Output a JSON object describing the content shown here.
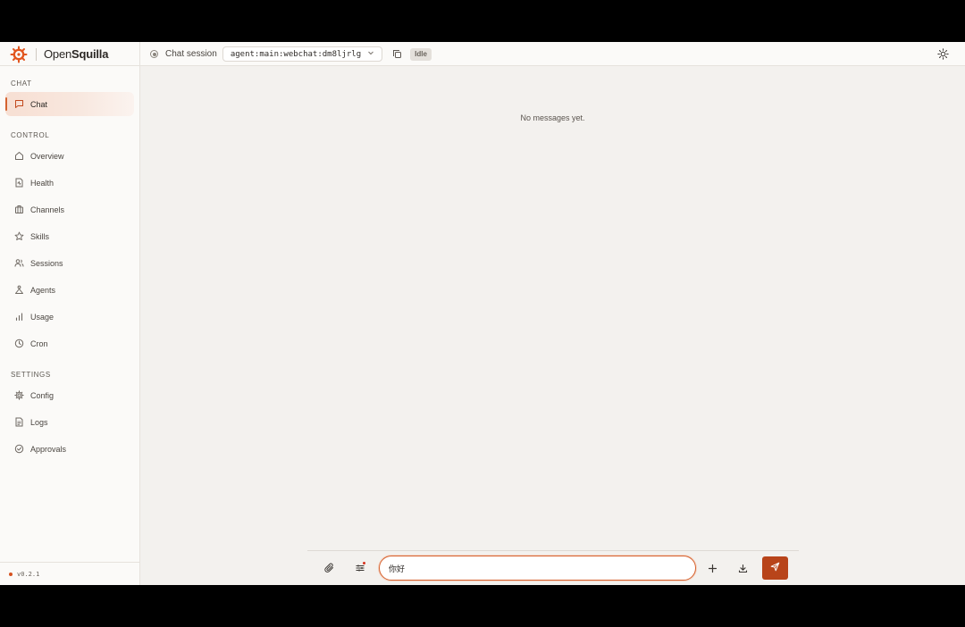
{
  "brand": {
    "name_prefix": "Open",
    "name_suffix": "Squilla",
    "logo_icon": "squid-logo-icon"
  },
  "header": {
    "session_label": "Chat session",
    "session_key": "agent:main:webchat:dm8ljrlg",
    "status": "Idle",
    "icons": {
      "status": "radio-dot-icon",
      "dropdown": "chevron-down-icon",
      "copy": "copy-icon",
      "theme": "sun-icon"
    }
  },
  "sidebar": {
    "sections": [
      {
        "title": "CHAT",
        "items": [
          {
            "label": "Chat",
            "icon": "message-square-icon",
            "active": true
          }
        ]
      },
      {
        "title": "CONTROL",
        "items": [
          {
            "label": "Overview",
            "icon": "home-icon"
          },
          {
            "label": "Health",
            "icon": "file-pulse-icon"
          },
          {
            "label": "Channels",
            "icon": "briefcase-icon"
          },
          {
            "label": "Skills",
            "icon": "star-icon"
          },
          {
            "label": "Sessions",
            "icon": "users-icon"
          },
          {
            "label": "Agents",
            "icon": "triangle-person-icon"
          },
          {
            "label": "Usage",
            "icon": "bar-chart-icon"
          },
          {
            "label": "Cron",
            "icon": "clock-icon"
          }
        ]
      },
      {
        "title": "SETTINGS",
        "items": [
          {
            "label": "Config",
            "icon": "gear-icon"
          },
          {
            "label": "Logs",
            "icon": "file-text-icon"
          },
          {
            "label": "Approvals",
            "icon": "check-circle-icon"
          }
        ]
      }
    ],
    "version": "v0.2.1"
  },
  "main": {
    "empty_message": "No messages yet.",
    "composer": {
      "input_value": "你好",
      "icons": {
        "attach": "paperclip-icon",
        "settings": "sliders-icon",
        "new": "plus-icon",
        "export": "download-icon",
        "send": "send-icon"
      }
    }
  },
  "colors": {
    "accent": "#b8441a",
    "accent_light": "#f7dfd3",
    "brand_orange": "#e2561f",
    "background": "#f3f1ee",
    "sidebar_bg": "#fbfaf8"
  }
}
